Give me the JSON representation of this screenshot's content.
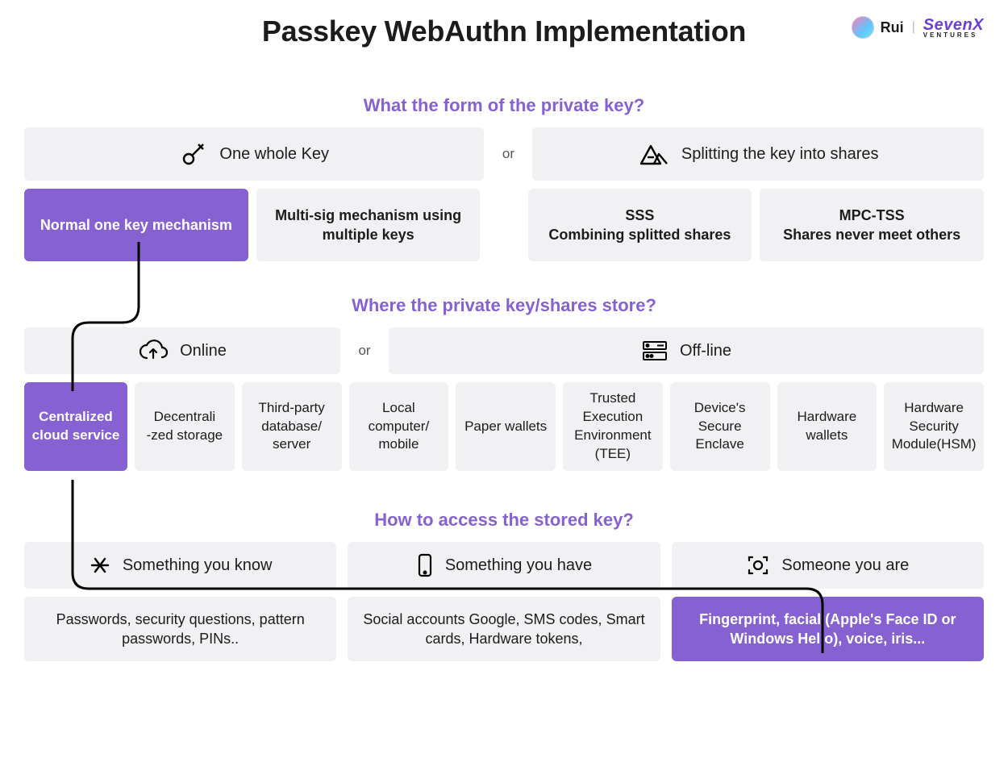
{
  "title": "Passkey WebAuthn Implementation",
  "brand": {
    "author": "Rui",
    "company": "SevenX",
    "subtitle": "VENTURES"
  },
  "section1": {
    "heading": "What the form of the private key?",
    "or": "or",
    "optA": "One whole Key",
    "optB": "Splitting the key into shares",
    "cards": [
      "Normal one key mechanism",
      "Multi-sig mechanism using multiple keys",
      "SSS\nCombining splitted shares",
      "MPC-TSS\nShares never meet others"
    ]
  },
  "section2": {
    "heading": "Where the private key/shares store?",
    "or": "or",
    "optA": "Online",
    "optB": "Off-line",
    "cards": [
      "Centralized cloud service",
      "Decentrali\n-zed storage",
      "Third-party database/\nserver",
      "Local computer/\nmobile",
      "Paper wallets",
      "Trusted Execution Environment (TEE)",
      "Device's Secure Enclave",
      "Hardware wallets",
      "Hardware Security Module(HSM)"
    ]
  },
  "section3": {
    "heading": "How to access the stored key?",
    "optA": "Something you know",
    "optB": "Something you have",
    "optC": "Someone you are",
    "cards": [
      "Passwords, security questions, pattern passwords, PINs..",
      "Social accounts Google, SMS codes, Smart cards, Hardware tokens,",
      "Fingerprint, facial (Apple's Face ID or Windows Hello), voice, iris..."
    ]
  }
}
